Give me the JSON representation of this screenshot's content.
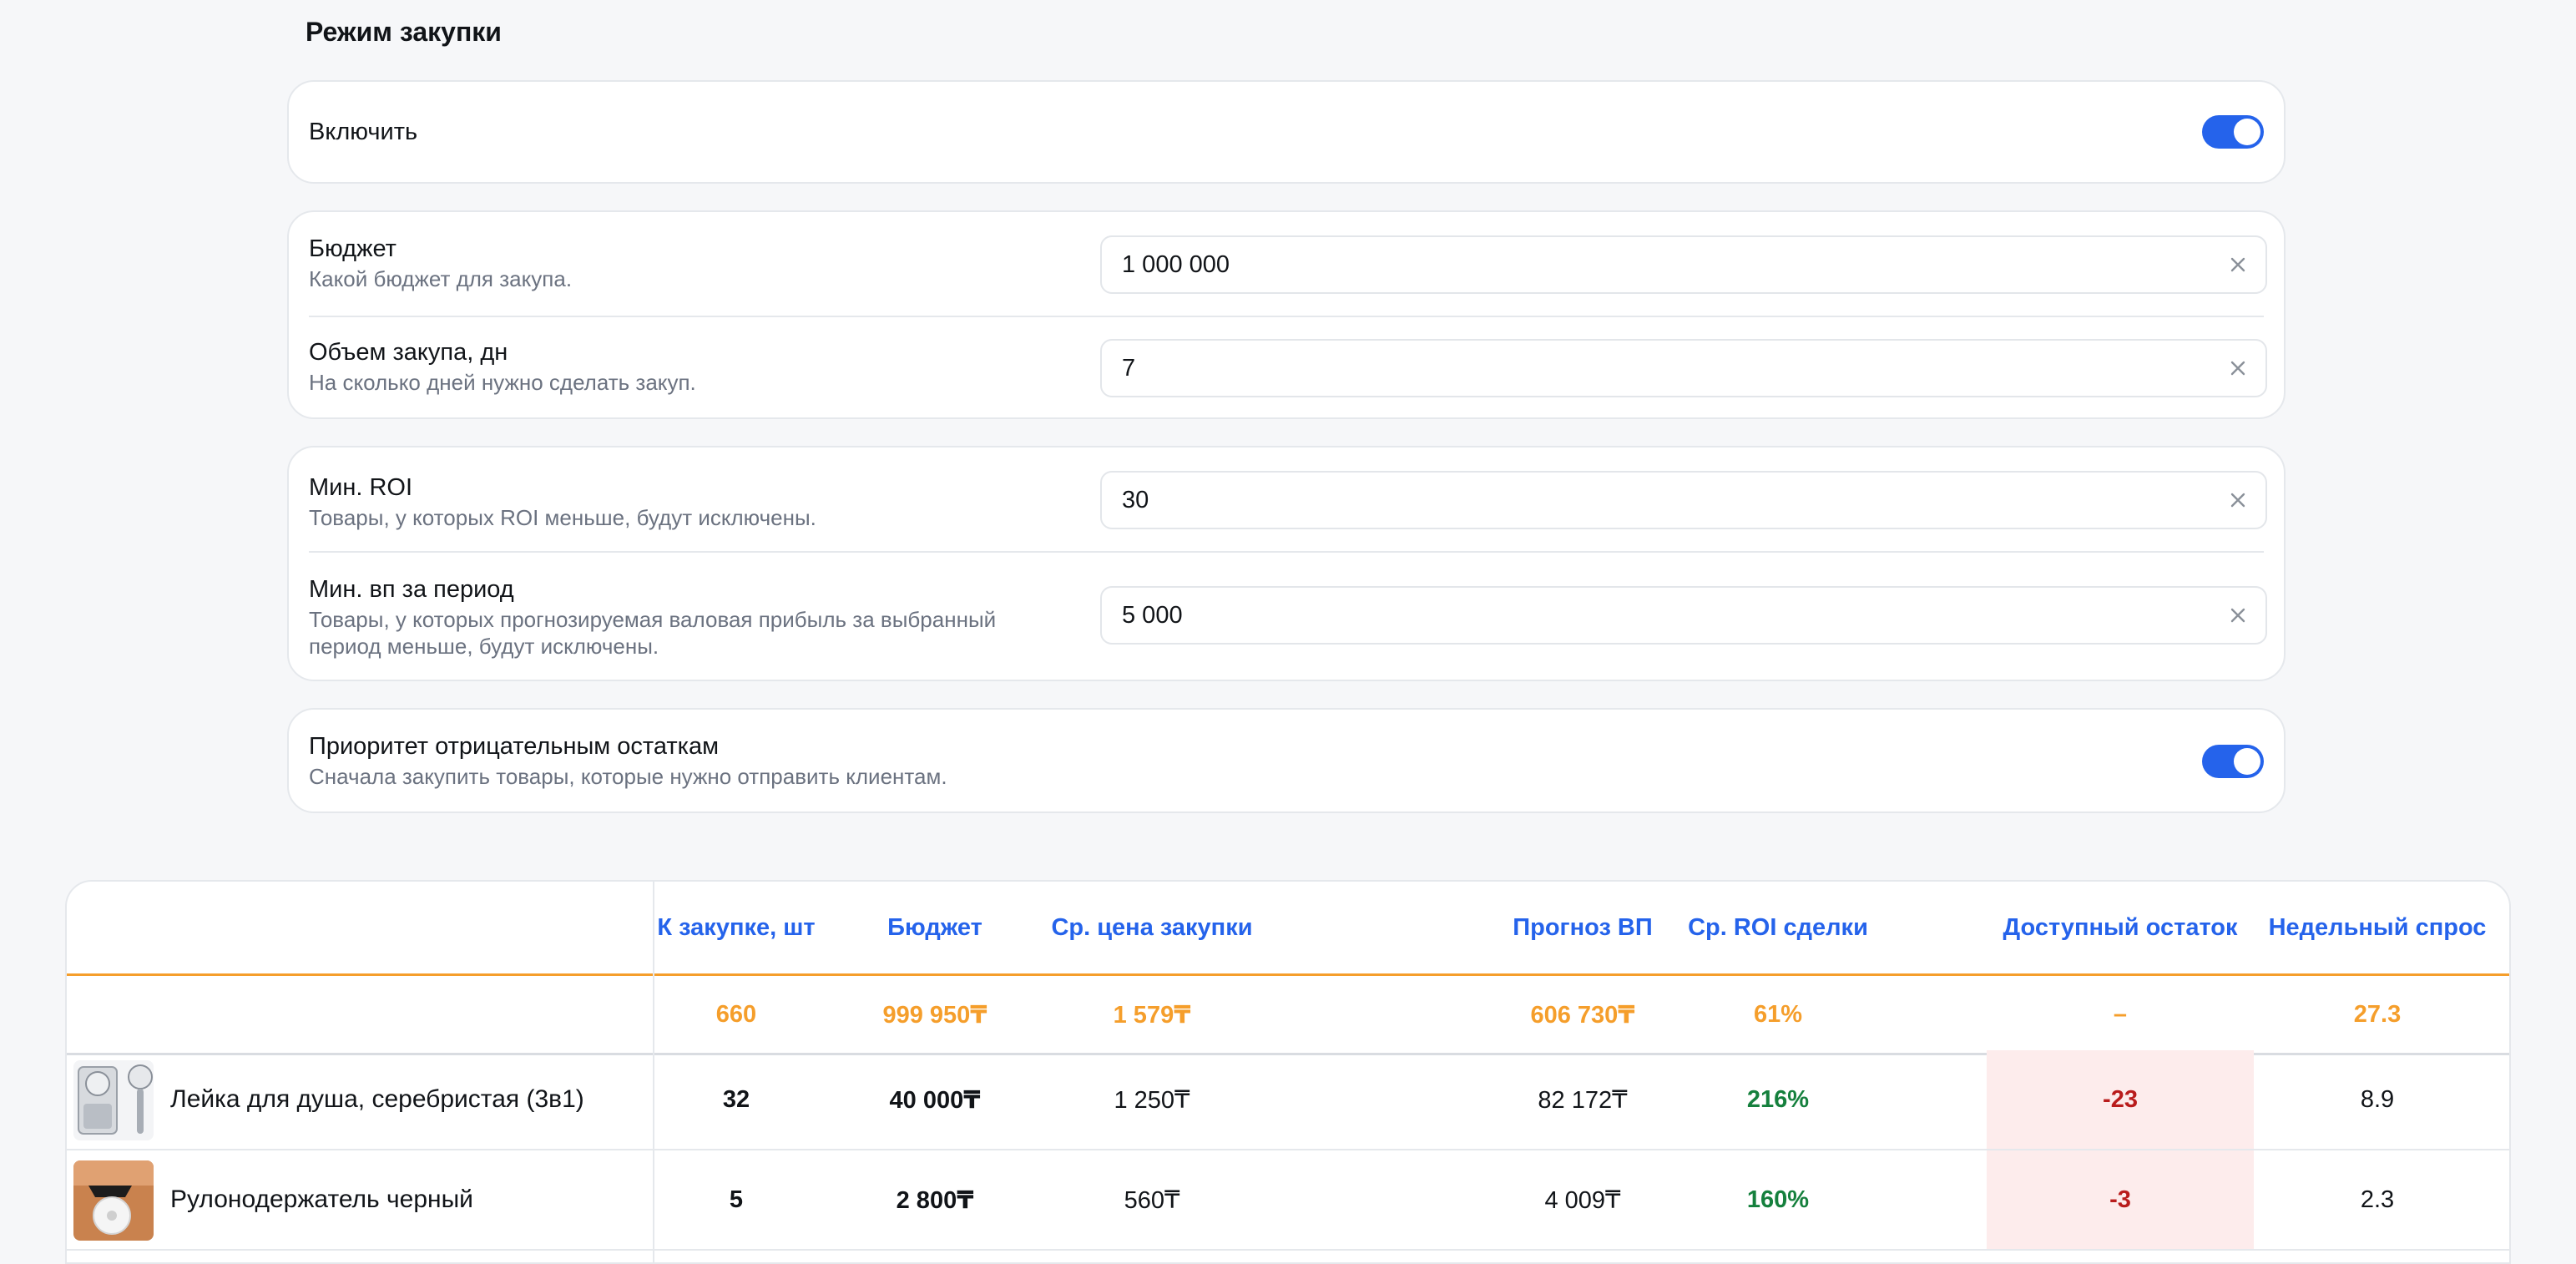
{
  "section_title": "Режим закупки",
  "enable": {
    "label": "Включить",
    "on": true
  },
  "budget": {
    "title": "Бюджет",
    "desc": "Какой бюджет для закупа.",
    "value": "1 000 000"
  },
  "volume": {
    "title": "Объем закупа, дн",
    "desc": "На сколько дней нужно сделать закуп.",
    "value": "7"
  },
  "min_roi": {
    "title": "Мин. ROI",
    "desc": "Товары, у которых ROI меньше, будут исключены.",
    "value": "30"
  },
  "min_gp": {
    "title": "Мин. вп за период",
    "desc_line1": "Товары, у которых прогнозируемая валовая прибыль за выбранный",
    "desc_line2": "период меньше, будут исключены.",
    "value": "5 000"
  },
  "priority": {
    "title": "Приоритет отрицательным остаткам",
    "desc": "Сначала закупить товары, которые нужно отправить клиентам.",
    "on": true
  },
  "table": {
    "headers": {
      "qty": "К закупке, шт",
      "budget": "Бюджет",
      "avg_price": "Ср. цена закупки",
      "forecast_gp": "Прогноз ВП",
      "avg_roi": "Ср. ROI сделки",
      "stock": "Доступный остаток",
      "weekly_demand": "Недельный спрос"
    },
    "summary": {
      "qty": "660",
      "budget": "999 950₸",
      "avg_price": "1 579₸",
      "forecast_gp": "606 730₸",
      "avg_roi": "61%",
      "stock": "–",
      "weekly_demand": "27.3"
    },
    "rows": [
      {
        "name": "Лейка для душа, серебристая (3в1)",
        "qty": "32",
        "budget": "40 000₸",
        "avg_price": "1 250₸",
        "forecast_gp": "82 172₸",
        "avg_roi": "216%",
        "stock": "-23",
        "weekly_demand": "8.9"
      },
      {
        "name": "Рулонодержатель черный",
        "qty": "5",
        "budget": "2 800₸",
        "avg_price": "560₸",
        "forecast_gp": "4 009₸",
        "avg_roi": "160%",
        "stock": "-3",
        "weekly_demand": "2.3"
      }
    ]
  },
  "colors": {
    "accent": "#2563eb",
    "summary": "#f59e2b",
    "positive": "#15803d",
    "negative": "#b91c1c",
    "negative_bg": "#fdecec"
  }
}
